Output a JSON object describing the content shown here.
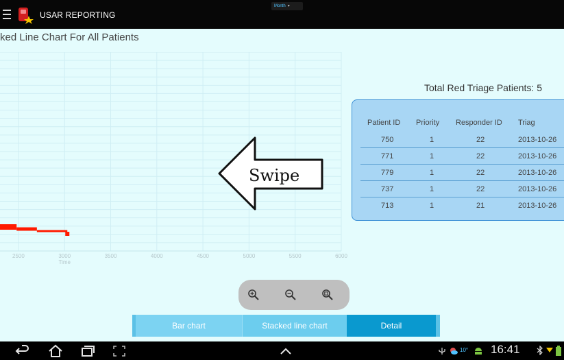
{
  "app": {
    "title": "USAR REPORTING",
    "filter_value": "Month"
  },
  "page": {
    "title": "ked Line Chart For All Patients"
  },
  "chart_data": {
    "type": "line",
    "xlabel": "Time",
    "xlim": [
      2300,
      6000
    ],
    "x_ticks": [
      "2500",
      "3000",
      "3500",
      "4000",
      "4500",
      "5000",
      "5500",
      "6000"
    ],
    "grid": true,
    "series": [
      {
        "color": "#ff1a00",
        "segments": [
          [
            2300,
            2480
          ],
          [
            2480,
            2700
          ],
          [
            2700,
            3030
          ]
        ]
      }
    ]
  },
  "overlay": {
    "swipe_text": "Swipe"
  },
  "summary": {
    "label": "Total Red Triage Patients: 5"
  },
  "table": {
    "headers": {
      "patient_id": "Patient ID",
      "priority": "Priority",
      "responder_id": "Responder ID",
      "triage": "Triag"
    },
    "rows": [
      {
        "patient_id": "750",
        "priority": "1",
        "responder_id": "22",
        "triage": "2013-10-26"
      },
      {
        "patient_id": "771",
        "priority": "1",
        "responder_id": "22",
        "triage": "2013-10-26"
      },
      {
        "patient_id": "779",
        "priority": "1",
        "responder_id": "22",
        "triage": "2013-10-26"
      },
      {
        "patient_id": "737",
        "priority": "1",
        "responder_id": "22",
        "triage": "2013-10-26"
      },
      {
        "patient_id": "713",
        "priority": "1",
        "responder_id": "21",
        "triage": "2013-10-26"
      }
    ]
  },
  "tabs": {
    "bar": "Bar chart",
    "stacked": "Stacked line chart",
    "detail": "Detail",
    "active": "detail"
  },
  "status": {
    "temperature": "10°",
    "time": "16:41"
  },
  "colors": {
    "accent": "#0a99cf",
    "series": "#ff1a00",
    "panel": "#a8d6f4",
    "background": "#e4fcfd"
  }
}
